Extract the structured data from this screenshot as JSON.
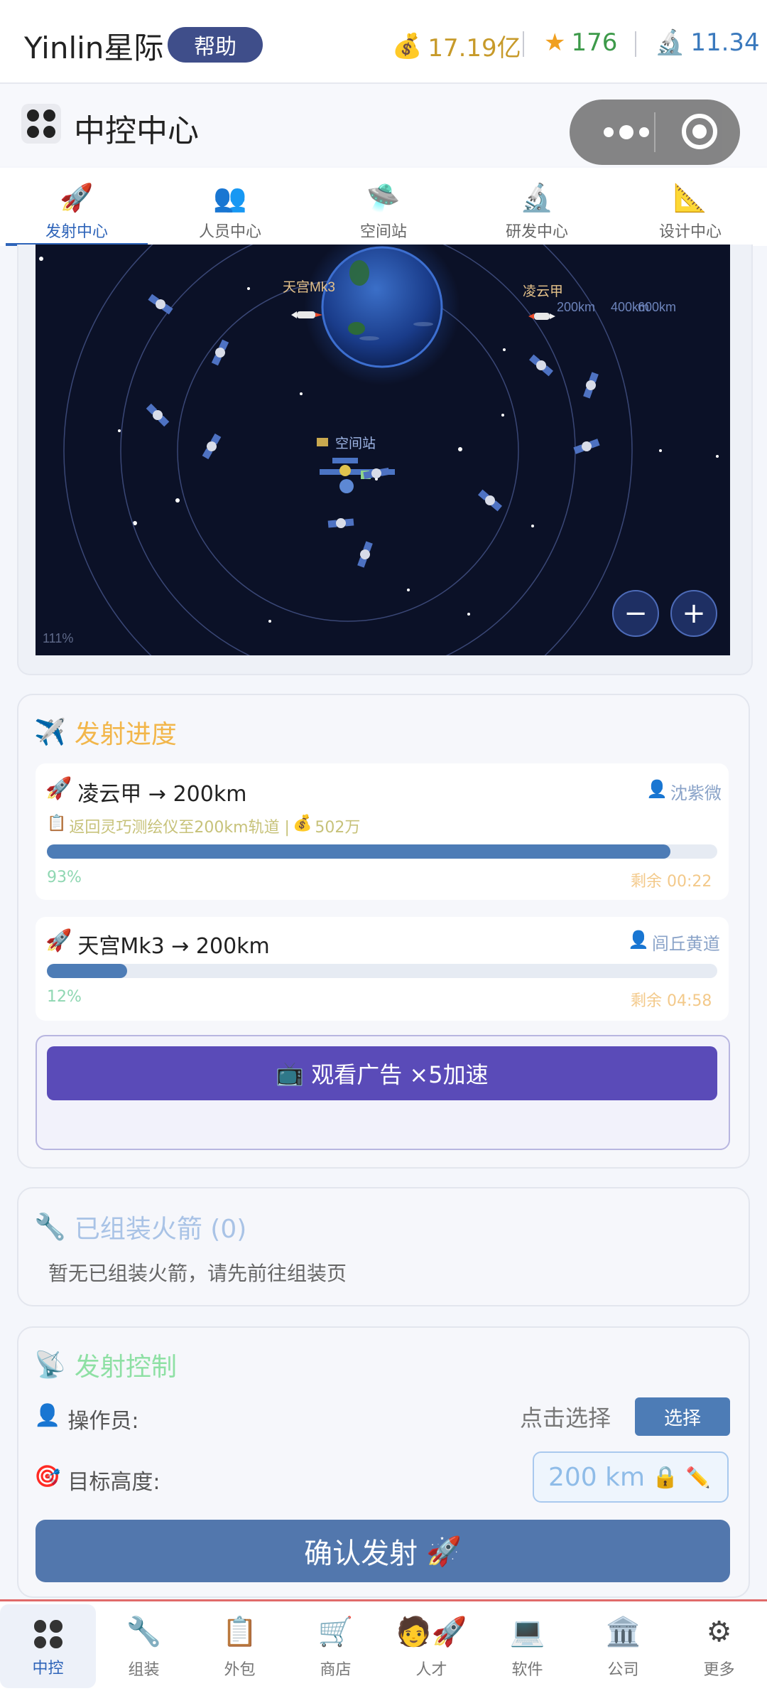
{
  "topbar": {
    "brand": "Yinlin星际",
    "help_label": "帮助",
    "money": "17.19亿",
    "stars": "176",
    "research": "11.34",
    "colors": {
      "money": "#c79a2a",
      "stars": "#3d9a4a",
      "research": "#3a79bd"
    }
  },
  "header": {
    "title": "中控中心"
  },
  "tabs": [
    {
      "label": "发射中心",
      "icon": "rocket-icon"
    },
    {
      "label": "人员中心",
      "icon": "people-icon"
    },
    {
      "label": "空间站",
      "icon": "ufo-icon"
    },
    {
      "label": "研发中心",
      "icon": "microscope-icon"
    },
    {
      "label": "设计中心",
      "icon": "ruler-icon"
    }
  ],
  "map": {
    "rocket1_label": "天宫Mk3",
    "rocket2_label": "凌云甲",
    "station_label": "空间站",
    "orbit_labels": [
      "200km",
      "400km",
      "600km"
    ],
    "zoom": "111%"
  },
  "progress": {
    "title": "发射进度",
    "items": [
      {
        "title": "凌云甲 → 200km",
        "operator": "沈紫微",
        "mission": "返回灵巧测绘仪至200km轨道 | ",
        "reward": "502万",
        "percent": "93%",
        "remaining": "剩余 00:22"
      },
      {
        "title": "天宫Mk3 → 200km",
        "operator": "闾丘黄道",
        "percent": "12%",
        "remaining": "剩余 04:58"
      }
    ],
    "ad_label": "观看广告 ×5加速"
  },
  "assembled": {
    "title": "已组装火箭 (0)",
    "empty_text": "暂无已组装火箭，请先前往组装页"
  },
  "control": {
    "title": "发射控制",
    "operator_label": "操作员:",
    "operator_value": "点击选择",
    "select_label": "选择",
    "altitude_label": "目标高度:",
    "altitude_value": "200 km",
    "confirm_label": "确认发射"
  },
  "bottom_nav": [
    {
      "label": "中控",
      "icon": "control-icon"
    },
    {
      "label": "组装",
      "icon": "wrench-icon"
    },
    {
      "label": "外包",
      "icon": "clipboard-icon"
    },
    {
      "label": "商店",
      "icon": "cart-icon"
    },
    {
      "label": "人才",
      "icon": "talent-icon"
    },
    {
      "label": "软件",
      "icon": "laptop-icon"
    },
    {
      "label": "公司",
      "icon": "building-icon"
    },
    {
      "label": "更多",
      "icon": "gear-icon"
    }
  ]
}
